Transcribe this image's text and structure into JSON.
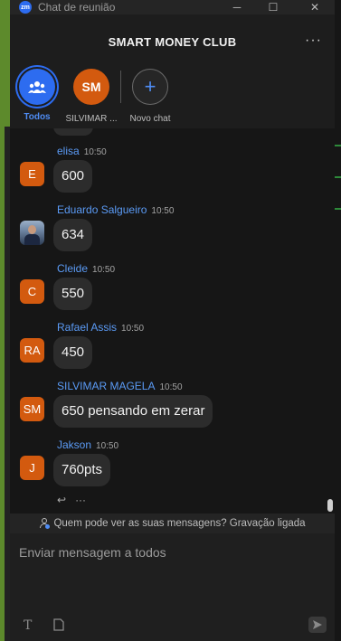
{
  "window": {
    "title": "Chat de reunião",
    "minimize_icon": "─",
    "maximize_icon": "☐",
    "close_icon": "✕"
  },
  "header": {
    "title": "SMART MONEY CLUB",
    "more_icon": "···"
  },
  "tabs": [
    {
      "label": "Todos",
      "icon": "people-icon",
      "color": "#2d6cf0",
      "active": true
    },
    {
      "label": "SILVIMAR ...",
      "initials": "SM",
      "color": "#d35a0f",
      "active": false
    },
    {
      "label": "Novo chat",
      "icon": "+",
      "color": "#2a2a2a",
      "active": false
    }
  ],
  "messages": [
    {
      "name": "elisa",
      "time": "10:50",
      "text": "600",
      "avatar": "E"
    },
    {
      "name": "Eduardo Salgueiro",
      "time": "10:50",
      "text": "634",
      "avatar": "photo"
    },
    {
      "name": "Cleide",
      "time": "10:50",
      "text": "550",
      "avatar": "C"
    },
    {
      "name": "Rafael Assis",
      "time": "10:50",
      "text": "450",
      "avatar": "RA"
    },
    {
      "name": "SILVIMAR MAGELA",
      "time": "10:50",
      "text": "650 pensando em zerar",
      "avatar": "SM"
    },
    {
      "name": "Jakson",
      "time": "10:50",
      "text": "760pts",
      "avatar": "J"
    }
  ],
  "reactions": {
    "reply_icon": "↩",
    "more_icon": "···"
  },
  "notice": {
    "text": "Quem pode ver as suas mensagens? Gravação ligada"
  },
  "composer": {
    "placeholder": "Enviar mensagem a todos",
    "format_icon": "T",
    "file_icon": "🗋",
    "send_icon": "➤"
  },
  "colors": {
    "accent": "#2d6cf0",
    "name_blue": "#5b9bf6",
    "avatar_orange": "#d35a0f",
    "bubble": "#2c2c2c"
  }
}
